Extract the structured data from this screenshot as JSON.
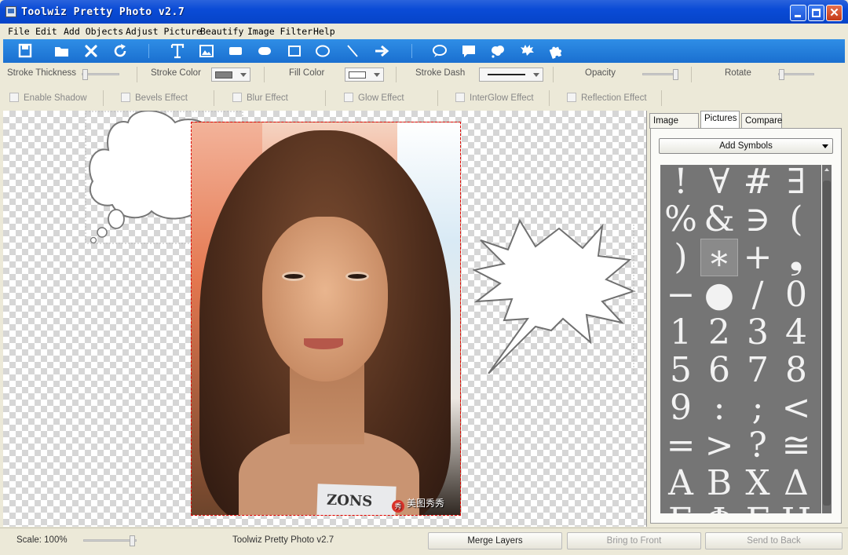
{
  "window": {
    "title": "Toolwiz Pretty Photo v2.7",
    "close_glyph": "✕"
  },
  "menu": [
    {
      "label": "File"
    },
    {
      "label": "Edit"
    },
    {
      "label": "Add Objects"
    },
    {
      "label": "Adjust Picture"
    },
    {
      "label": "Beautify"
    },
    {
      "label": "Image Filter"
    },
    {
      "label": "Help"
    }
  ],
  "toolbar": {
    "icons": [
      "save-icon",
      "open-folder-icon",
      "delete-icon",
      "refresh-icon",
      "text-icon",
      "picture-icon",
      "rounded-rect-icon",
      "rounded-rect-icon",
      "rectangle-icon",
      "ellipse-icon",
      "line-icon",
      "arrow-icon",
      "speech-bubble-icon",
      "rect-bubble-icon",
      "cloud-bubble-icon",
      "spiky-bubble-icon",
      "puzzle-icon"
    ]
  },
  "props": {
    "stroke_thickness": "Stroke Thickness",
    "stroke_color": "Stroke Color",
    "stroke_color_value": "#808080",
    "fill_color": "Fill Color",
    "fill_color_value": "#ffffff",
    "stroke_dash": "Stroke Dash",
    "opacity": "Opacity",
    "rotate": "Rotate",
    "effects": [
      "Enable Shadow",
      "Bevels Effect",
      "Blur Effect",
      "Glow Effect",
      "InterGlow Effect",
      "Reflection Effect"
    ]
  },
  "canvas": {
    "shirt_text": "ZONS",
    "watermark_seal": "秀",
    "watermark": "美图秀秀"
  },
  "panel": {
    "tabs": [
      {
        "label": "Image Filter"
      },
      {
        "label": "Pictures",
        "active": true
      },
      {
        "label": "Compare"
      }
    ],
    "add_symbols": "Add Symbols",
    "symbols": [
      "!",
      "∀",
      "#",
      "∃",
      "%",
      "&",
      "∋",
      "(",
      ")",
      "∗",
      "+",
      "❟",
      "−",
      "●",
      "/",
      "0",
      "1",
      "2",
      "3",
      "4",
      "5",
      "6",
      "7",
      "8",
      "9",
      ":",
      ";",
      "<",
      "=",
      ">",
      "?",
      "≅",
      "Α",
      "Β",
      "Χ",
      "Δ",
      "Ε",
      "Φ",
      "Γ",
      "Η"
    ],
    "selected_symbol": "∗"
  },
  "status": {
    "scale": "Scale: 100%",
    "scale_value": 100,
    "app_name": "Toolwiz Pretty Photo v2.7",
    "merge_layers": "Merge Layers",
    "bring_to_front": "Bring to Front",
    "send_to_back": "Send to Back"
  }
}
